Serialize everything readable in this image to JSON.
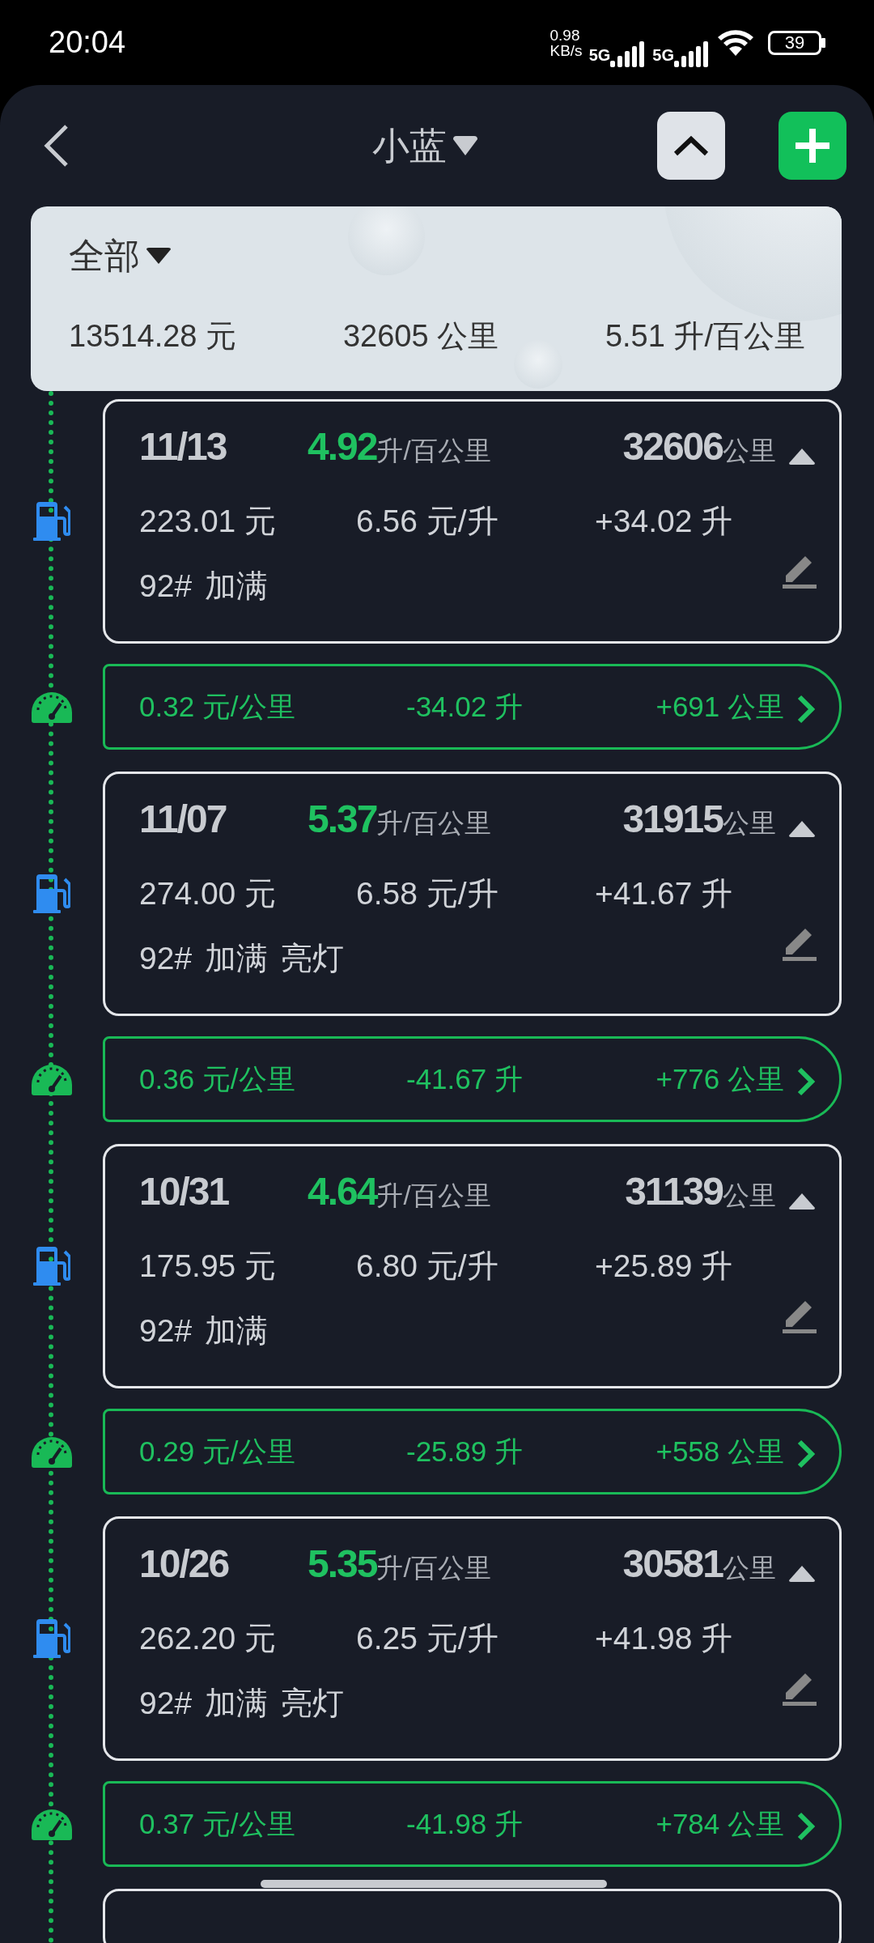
{
  "status_bar": {
    "time": "20:04",
    "net_speed": "0.98",
    "net_unit": "KB/s",
    "sim_1": "5G",
    "sim_2": "5G",
    "battery": "39"
  },
  "header": {
    "title": "小蓝"
  },
  "summary": {
    "filter": "全部",
    "total_cost": "13514.28 元",
    "total_distance": "32605 公里",
    "avg_consumption": "5.51 升/百公里"
  },
  "timeline": [
    {
      "kind": "refuel",
      "date": "11/13",
      "consumption": "4.92",
      "consumption_unit": "升/百公里",
      "odometer": "32606",
      "odometer_unit": "公里",
      "cost": "223.01 元",
      "price": "6.56 元/升",
      "volume": "+34.02 升",
      "tags": [
        "92#",
        "加满"
      ]
    },
    {
      "kind": "segment",
      "cost_per_km": "0.32 元/公里",
      "fuel_used": "-34.02 升",
      "distance": "+691 公里"
    },
    {
      "kind": "refuel",
      "date": "11/07",
      "consumption": "5.37",
      "consumption_unit": "升/百公里",
      "odometer": "31915",
      "odometer_unit": "公里",
      "cost": "274.00 元",
      "price": "6.58 元/升",
      "volume": "+41.67 升",
      "tags": [
        "92#",
        "加满",
        "亮灯"
      ]
    },
    {
      "kind": "segment",
      "cost_per_km": "0.36 元/公里",
      "fuel_used": "-41.67 升",
      "distance": "+776 公里"
    },
    {
      "kind": "refuel",
      "date": "10/31",
      "consumption": "4.64",
      "consumption_unit": "升/百公里",
      "odometer": "31139",
      "odometer_unit": "公里",
      "cost": "175.95 元",
      "price": "6.80 元/升",
      "volume": "+25.89 升",
      "tags": [
        "92#",
        "加满"
      ]
    },
    {
      "kind": "segment",
      "cost_per_km": "0.29 元/公里",
      "fuel_used": "-25.89 升",
      "distance": "+558 公里"
    },
    {
      "kind": "refuel",
      "date": "10/26",
      "consumption": "5.35",
      "consumption_unit": "升/百公里",
      "odometer": "30581",
      "odometer_unit": "公里",
      "cost": "262.20 元",
      "price": "6.25 元/升",
      "volume": "+41.98 升",
      "tags": [
        "92#",
        "加满",
        "亮灯"
      ]
    },
    {
      "kind": "segment",
      "cost_per_km": "0.37 元/公里",
      "fuel_used": "-41.98 升",
      "distance": "+784 公里"
    },
    {
      "kind": "partial"
    }
  ]
}
